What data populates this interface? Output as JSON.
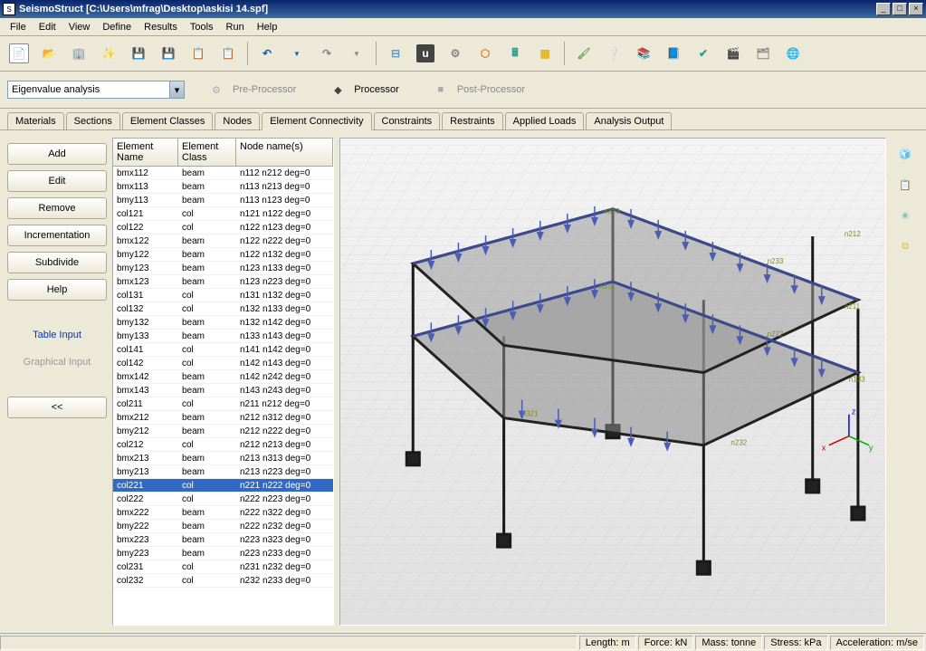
{
  "title": "SeismoStruct   [C:\\Users\\mfrag\\Desktop\\askisi 14.spf]",
  "menu": [
    "File",
    "Edit",
    "View",
    "Define",
    "Results",
    "Tools",
    "Run",
    "Help"
  ],
  "analysis_combo": "Eigenvalue analysis",
  "processors": {
    "pre": "Pre-Processor",
    "proc": "Processor",
    "post": "Post-Processor"
  },
  "tabs": [
    "Materials",
    "Sections",
    "Element Classes",
    "Nodes",
    "Element Connectivity",
    "Constraints",
    "Restraints",
    "Applied Loads",
    "Analysis Output"
  ],
  "active_tab": 4,
  "side_buttons": {
    "add": "Add",
    "edit": "Edit",
    "remove": "Remove",
    "inc": "Incrementation",
    "sub": "Subdivide",
    "help": "Help",
    "table": "Table Input",
    "graphical": "Graphical Input",
    "collapse": "<<"
  },
  "table": {
    "headers": [
      "Element Name",
      "Element Class",
      "Node name(s)"
    ],
    "selected_index": 20,
    "rows": [
      {
        "name": "bmx112",
        "cls": "beam",
        "nodes": "n112  n212  deg=0"
      },
      {
        "name": "bmx113",
        "cls": "beam",
        "nodes": "n113  n213  deg=0"
      },
      {
        "name": "bmy113",
        "cls": "beam",
        "nodes": "n113  n123  deg=0"
      },
      {
        "name": "col121",
        "cls": "col",
        "nodes": "n121  n122  deg=0"
      },
      {
        "name": "col122",
        "cls": "col",
        "nodes": "n122  n123  deg=0"
      },
      {
        "name": "bmx122",
        "cls": "beam",
        "nodes": "n122  n222  deg=0"
      },
      {
        "name": "bmy122",
        "cls": "beam",
        "nodes": "n122  n132  deg=0"
      },
      {
        "name": "bmy123",
        "cls": "beam",
        "nodes": "n123  n133  deg=0"
      },
      {
        "name": "bmx123",
        "cls": "beam",
        "nodes": "n123  n223  deg=0"
      },
      {
        "name": "col131",
        "cls": "col",
        "nodes": "n131  n132  deg=0"
      },
      {
        "name": "col132",
        "cls": "col",
        "nodes": "n132  n133  deg=0"
      },
      {
        "name": "bmy132",
        "cls": "beam",
        "nodes": "n132  n142  deg=0"
      },
      {
        "name": "bmy133",
        "cls": "beam",
        "nodes": "n133  n143  deg=0"
      },
      {
        "name": "col141",
        "cls": "col",
        "nodes": "n141  n142  deg=0"
      },
      {
        "name": "col142",
        "cls": "col",
        "nodes": "n142  n143  deg=0"
      },
      {
        "name": "bmx142",
        "cls": "beam",
        "nodes": "n142  n242  deg=0"
      },
      {
        "name": "bmx143",
        "cls": "beam",
        "nodes": "n143  n243  deg=0"
      },
      {
        "name": "col211",
        "cls": "col",
        "nodes": "n211  n212  deg=0"
      },
      {
        "name": "bmx212",
        "cls": "beam",
        "nodes": "n212  n312  deg=0"
      },
      {
        "name": "bmy212",
        "cls": "beam",
        "nodes": "n212  n222  deg=0"
      },
      {
        "name": "col212",
        "cls": "col",
        "nodes": "n212  n213  deg=0"
      },
      {
        "name": "bmx213",
        "cls": "beam",
        "nodes": "n213  n313  deg=0"
      },
      {
        "name": "bmy213",
        "cls": "beam",
        "nodes": "n213  n223  deg=0"
      },
      {
        "name": "col221",
        "cls": "col",
        "nodes": "n221  n222  deg=0"
      },
      {
        "name": "col222",
        "cls": "col",
        "nodes": "n222  n223  deg=0"
      },
      {
        "name": "bmx222",
        "cls": "beam",
        "nodes": "n222  n322  deg=0"
      },
      {
        "name": "bmy222",
        "cls": "beam",
        "nodes": "n222  n232  deg=0"
      },
      {
        "name": "bmx223",
        "cls": "beam",
        "nodes": "n223  n323  deg=0"
      },
      {
        "name": "bmy223",
        "cls": "beam",
        "nodes": "n223  n233  deg=0"
      },
      {
        "name": "col231",
        "cls": "col",
        "nodes": "n231  n232  deg=0"
      },
      {
        "name": "col232",
        "cls": "col",
        "nodes": "n232  n233  deg=0"
      }
    ]
  },
  "status": {
    "length": "Length: m",
    "force": "Force: kN",
    "mass": "Mass: tonne",
    "stress": "Stress: kPa",
    "accel": "Acceleration: m/se"
  }
}
